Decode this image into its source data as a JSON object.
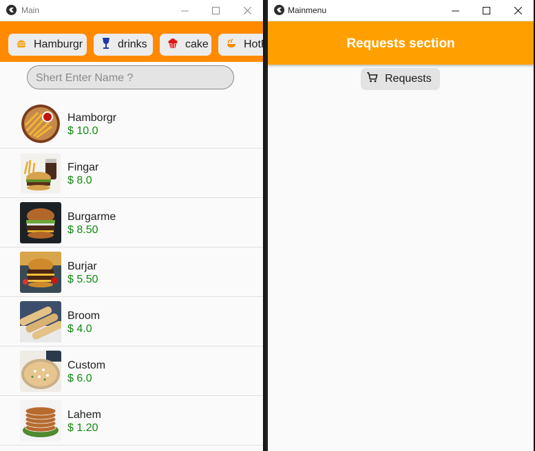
{
  "main_window": {
    "title": "Main",
    "categories": [
      {
        "label": "Hamburgr",
        "icon": "burger-icon"
      },
      {
        "label": "drinks",
        "icon": "glass-icon"
      },
      {
        "label": "cake",
        "icon": "cupcake-icon"
      },
      {
        "label": "HotF",
        "icon": "hotfood-icon"
      }
    ],
    "search": {
      "placeholder": "Shert Enter Name ?"
    },
    "items": [
      {
        "name": "Hamborgr",
        "price": "$ 10.0"
      },
      {
        "name": "Fingar",
        "price": "$ 8.0"
      },
      {
        "name": "Burgarme",
        "price": "$ 8.50"
      },
      {
        "name": "Burjar",
        "price": "$ 5.50"
      },
      {
        "name": "Broom",
        "price": "$ 4.0"
      },
      {
        "name": "Custom",
        "price": "$ 6.0"
      },
      {
        "name": "Lahem",
        "price": "$ 1.20"
      }
    ]
  },
  "menu_window": {
    "title": "Mainmenu",
    "header": "Requests section",
    "requests_button": "Requests"
  },
  "colors": {
    "category_bar": "#ff8a00",
    "requests_bar": "#ffa000",
    "price": "#108a10"
  }
}
